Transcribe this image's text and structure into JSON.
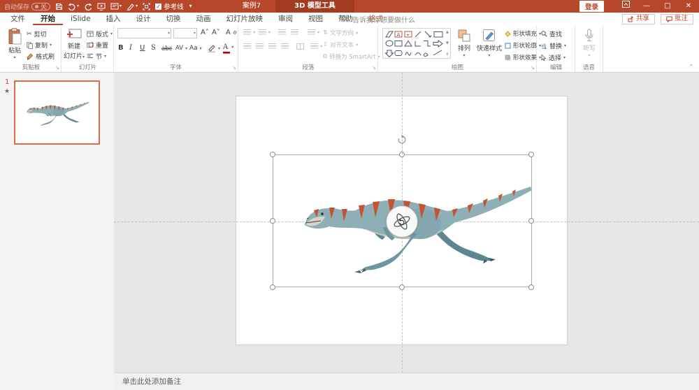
{
  "colors": {
    "titlebar": "#B7472A",
    "contextual_tab_bg": "#A23B20",
    "accent": "#C0502F",
    "selection_border": "#E06B4A",
    "editing_bg": "#E6E6E6",
    "dino_body": "#8FAFB6",
    "dino_stripe": "#C25434"
  },
  "title_bar": {
    "autosave_label": "自动保存",
    "autosave_state": "关",
    "guides_label": "参考线",
    "document_title": "案例7",
    "contextual_tab": "3D 模型工具",
    "login_label": "登录",
    "minimize": "—",
    "maximize": "□",
    "close": "✕"
  },
  "icons": {
    "qat": [
      "save-icon",
      "undo-icon",
      "redo-icon",
      "start-slideshow-icon",
      "slide-layout-icon",
      "pen-icon",
      "grid-box-icon",
      "qat-more-icon"
    ],
    "tellme": "search-icon",
    "window": [
      "ribbon-display-options-icon",
      "minimize-icon",
      "maximize-icon",
      "close-icon"
    ]
  },
  "tabs": [
    {
      "label": "文件"
    },
    {
      "label": "开始",
      "state": "active"
    },
    {
      "label": "iSlide"
    },
    {
      "label": "插入"
    },
    {
      "label": "设计"
    },
    {
      "label": "切换"
    },
    {
      "label": "动画"
    },
    {
      "label": "幻灯片放映"
    },
    {
      "label": "审阅"
    },
    {
      "label": "视图"
    },
    {
      "label": "帮助"
    },
    {
      "label": "格式",
      "state": "contextual"
    }
  ],
  "tellme_text": "告诉我你想要做什么",
  "share_label": "共享",
  "comments_label": "批注",
  "ribbon": {
    "clipboard": {
      "label": "剪贴板",
      "paste": "粘贴",
      "cut": "剪切",
      "copy": "复制",
      "format_painter": "格式刷"
    },
    "slides": {
      "label": "幻灯片",
      "new_slide_line1": "新建",
      "new_slide_line2": "幻灯片",
      "layout": "版式",
      "reset": "重置",
      "section": "节"
    },
    "font": {
      "label": "字体",
      "bold": "B",
      "italic": "I",
      "underline": "U",
      "shadow": "S",
      "strike": "abc",
      "char_spacing": "AV",
      "change_case": "Aa",
      "grow": "A˄",
      "shrink": "A˅",
      "clear": "A"
    },
    "paragraph": {
      "label": "段落",
      "text_direction": "文字方向",
      "align_text": "对齐文本",
      "smartart": "转换为 SmartArt"
    },
    "drawing": {
      "label": "绘图",
      "arrange": "排列",
      "quick_styles": "快速样式",
      "shape_fill": "形状填充",
      "shape_outline": "形状轮廓",
      "shape_effects": "形状效果"
    },
    "editing": {
      "label": "编辑",
      "find": "查找",
      "replace": "替换",
      "select": "选择"
    },
    "voice": {
      "label": "语音",
      "dictate": "听写"
    }
  },
  "slide_panel": {
    "slide_number": "1",
    "animation_indicator": "★"
  },
  "notes_placeholder": "单击此处添加备注"
}
